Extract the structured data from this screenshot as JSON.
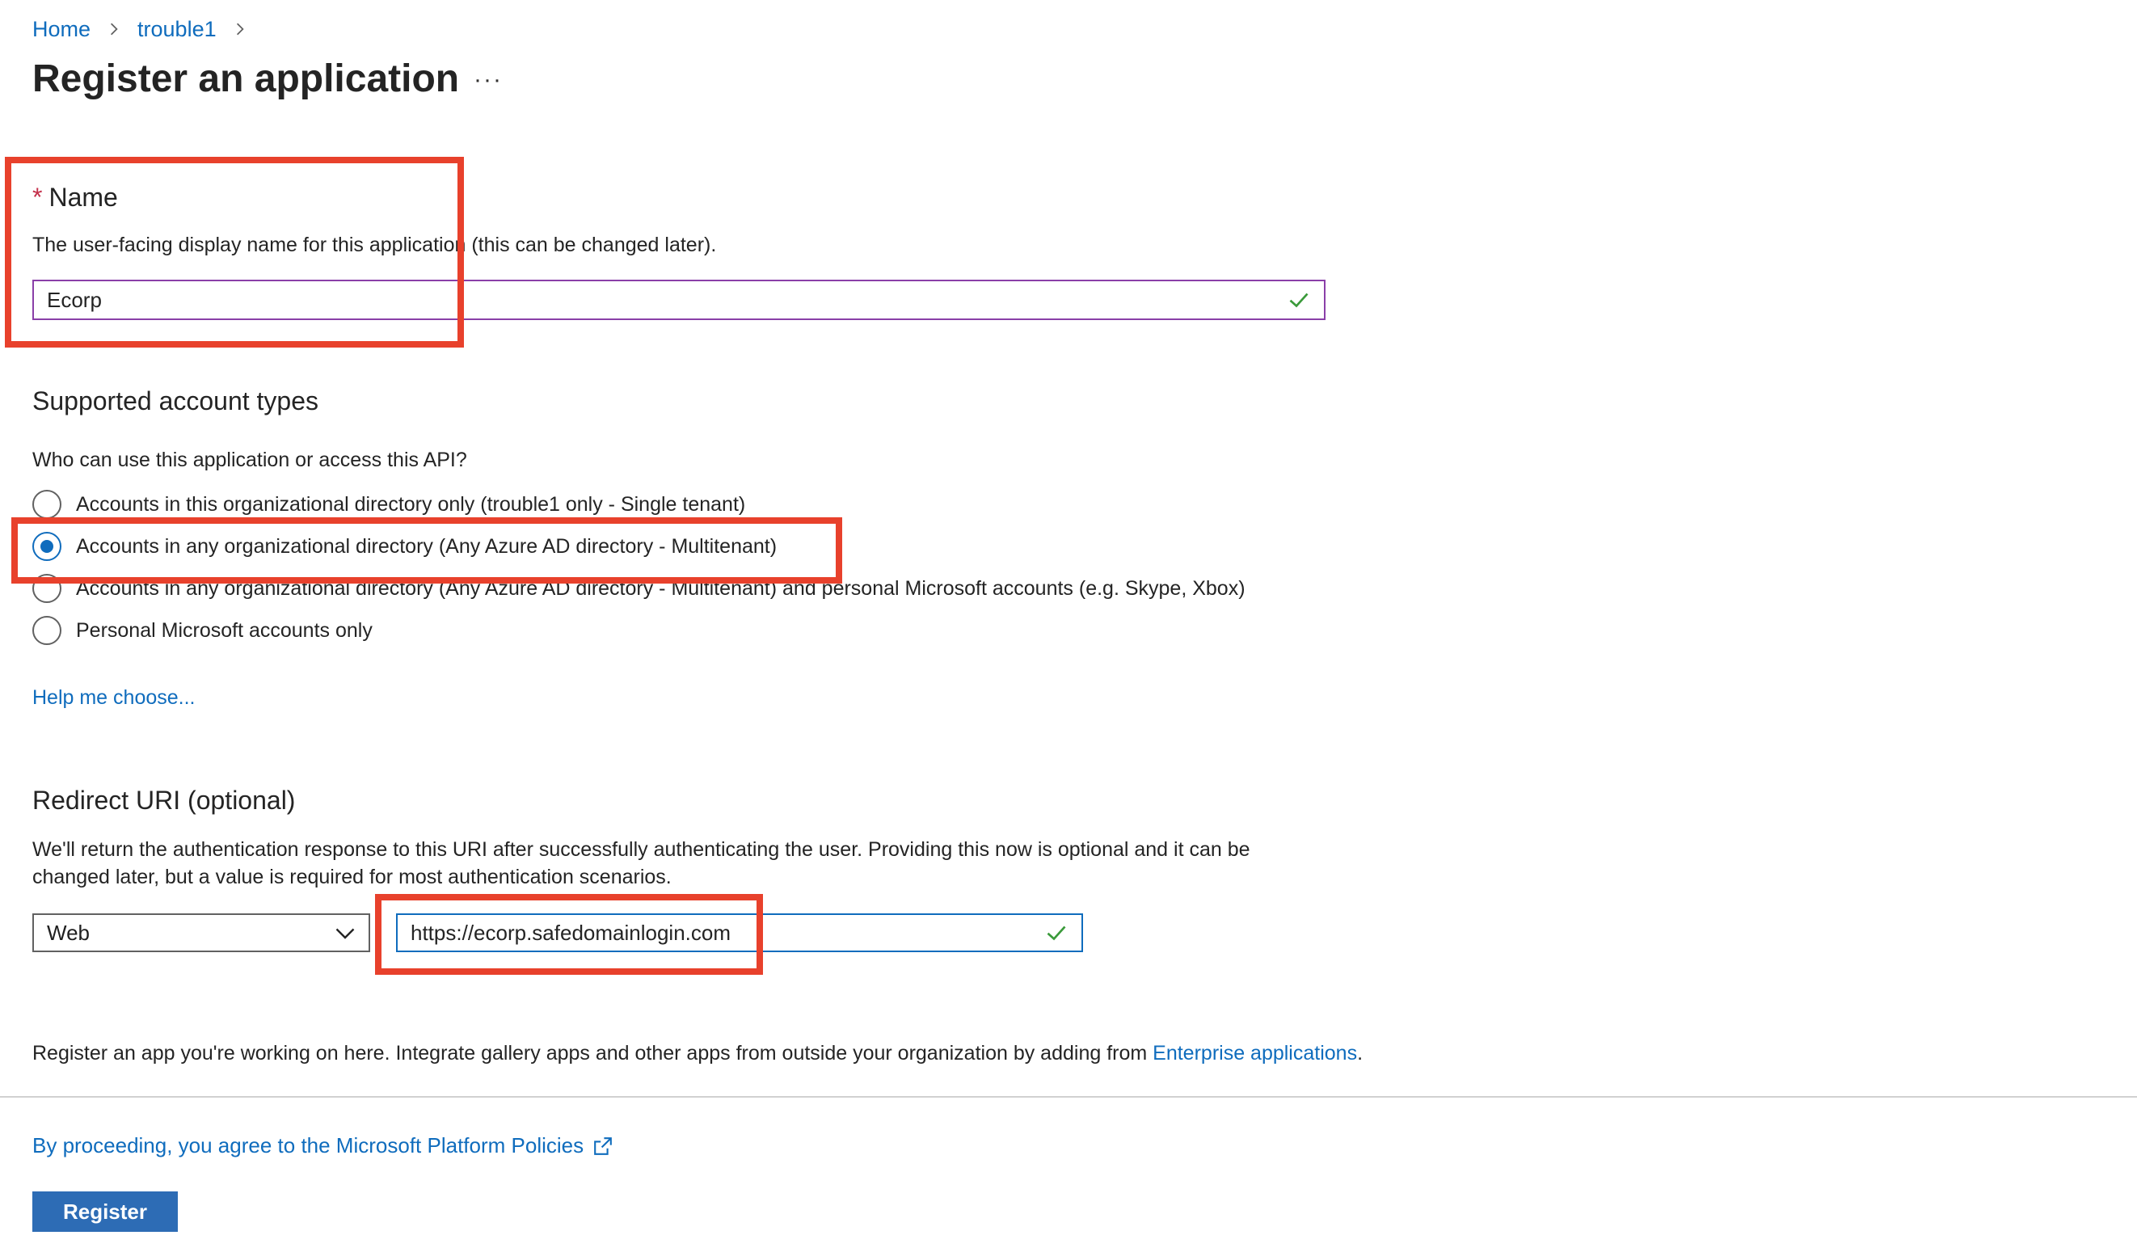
{
  "breadcrumb": {
    "items": [
      {
        "label": "Home"
      },
      {
        "label": "trouble1"
      }
    ]
  },
  "page": {
    "title": "Register an application",
    "more_label": "···"
  },
  "name_section": {
    "required_mark": "*",
    "label": "Name",
    "description": "The user-facing display name for this application (this can be changed later).",
    "value": "Ecorp"
  },
  "account_types": {
    "title": "Supported account types",
    "question": "Who can use this application or access this API?",
    "options": [
      {
        "label": "Accounts in this organizational directory only (trouble1 only - Single tenant)",
        "selected": false
      },
      {
        "label": "Accounts in any organizational directory (Any Azure AD directory - Multitenant)",
        "selected": true
      },
      {
        "label": "Accounts in any organizational directory (Any Azure AD directory - Multitenant) and personal Microsoft accounts (e.g. Skype, Xbox)",
        "selected": false
      },
      {
        "label": "Personal Microsoft accounts only",
        "selected": false
      }
    ],
    "help_link": "Help me choose..."
  },
  "redirect": {
    "title": "Redirect URI (optional)",
    "description_line1": "We'll return the authentication response to this URI after successfully authenticating the user. Providing this now is optional and it can be",
    "description_line2": "changed later, but a value is required for most authentication scenarios.",
    "platform_value": "Web",
    "uri_value": "https://ecorp.safedomainlogin.com"
  },
  "footer": {
    "note_prefix": "Register an app you're working on here. Integrate gallery apps and other apps from outside your organization by adding from ",
    "note_link": "Enterprise applications",
    "note_suffix": ".",
    "policy_link": "By proceeding, you agree to the Microsoft Platform Policies",
    "register_label": "Register"
  },
  "colors": {
    "accent": "#0f6cbd",
    "annotation": "#e8412c",
    "required": "#c4314b",
    "valid_check": "#3a9a3a"
  }
}
